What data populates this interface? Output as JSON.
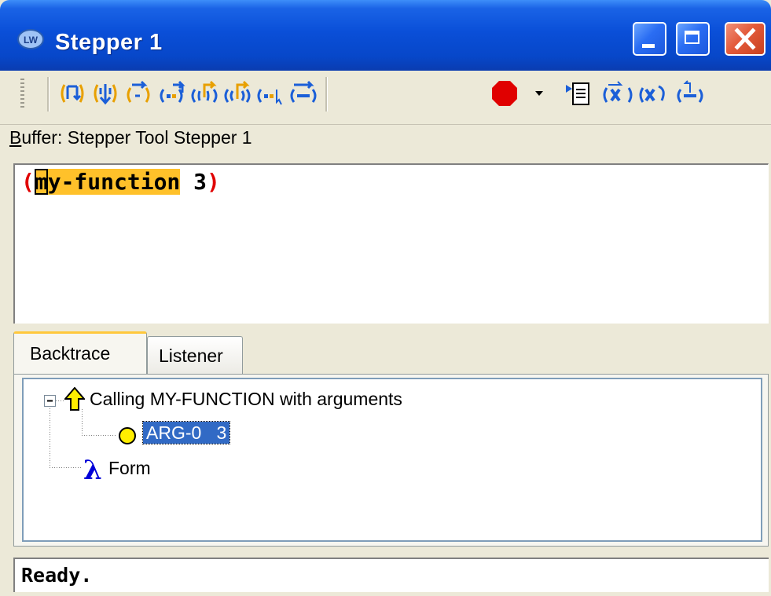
{
  "window": {
    "title": "Stepper 1"
  },
  "toolbar": {
    "icons": [
      "step-icon",
      "step-into-icon",
      "step-next-icon",
      "step-over-icon",
      "step-out-icon",
      "step-up-icon",
      "step-to-cursor-icon",
      "continue-icon",
      "breakpoint-icon",
      "dropdown-arrow-icon",
      "show-source-icon",
      "restart-frame-icon",
      "return-from-frame-icon",
      "abort-icon"
    ],
    "breakpoint_color": "#e00000",
    "icon_color": "#1b5fd8",
    "accent_color": "#e8a000"
  },
  "buffer": {
    "label_hotkey": "B",
    "label_rest": "uffer: Stepper Tool Stepper 1"
  },
  "editor": {
    "open_paren": "(",
    "cursor_char": "m",
    "function_rest": "y-function",
    "space": " ",
    "arg": "3",
    "close_paren": ")",
    "highlight_color": "#ffc12a"
  },
  "tabs": [
    {
      "label": "Backtrace",
      "selected": true
    },
    {
      "label": "Listener",
      "selected": false
    }
  ],
  "tree": {
    "root": {
      "label": "Calling MY-FUNCTION with arguments",
      "expander": "⊟",
      "icon": "up-arrow-icon"
    },
    "child": {
      "label": "ARG-0   3",
      "icon": "circle-icon",
      "selected": true
    },
    "form": {
      "label": "Form",
      "icon": "lambda-icon",
      "glyph": "λ"
    }
  },
  "status": {
    "text": "Ready."
  }
}
